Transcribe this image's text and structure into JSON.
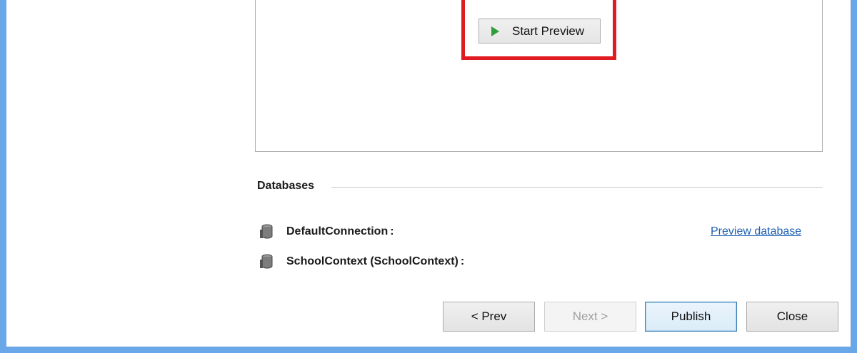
{
  "preview": {
    "start_button_label": "Start Preview",
    "start_button_icon": "play-icon",
    "highlight_color": "#e11b22"
  },
  "databases": {
    "section_title": "Databases",
    "items": [
      {
        "name": "DefaultConnection",
        "suffix": ":",
        "icon": "database-icon"
      },
      {
        "name": "SchoolContext (SchoolContext)",
        "suffix": ":",
        "icon": "database-icon"
      }
    ],
    "preview_link": "Preview database"
  },
  "footer": {
    "prev_label": "< Prev",
    "next_label": "Next >",
    "publish_label": "Publish",
    "close_label": "Close"
  },
  "colors": {
    "window_border": "#6aa7e8",
    "link": "#1e5fb4",
    "play_icon": "#2e9e3a"
  }
}
